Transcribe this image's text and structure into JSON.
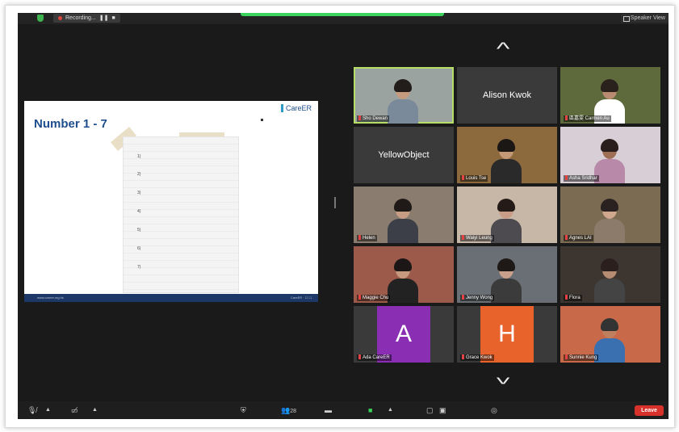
{
  "topbar": {
    "recording_label": "Recording...",
    "view_label": "Speaker View"
  },
  "slide": {
    "title": "Number 1 - 7",
    "logo": "CareER",
    "numbers": [
      "1)",
      "2)",
      "3)",
      "4)",
      "5)",
      "6)",
      "7)"
    ],
    "footer_left": "www.career.org.hk",
    "footer_right": "CareER · ☐ ☐"
  },
  "tiles": [
    {
      "name": "Sho Dewan",
      "type": "video",
      "skin": "#c59b7f",
      "hair": "#221c1a",
      "shirt": "#7a8a9a",
      "bg": "#9aa3a0",
      "active": true
    },
    {
      "name": "Alison Kwok",
      "type": "name"
    },
    {
      "name": "區嘉雯 Carmen Au",
      "type": "video",
      "skin": "#b98c71",
      "hair": "#2b211c",
      "shirt": "#ffffff",
      "bg": "#5e6a3c"
    },
    {
      "name": "YellowObject",
      "type": "name"
    },
    {
      "name": "Louis Tse",
      "type": "video",
      "skin": "#c49a76",
      "hair": "#1b1715",
      "shirt": "#2a2a2a",
      "bg": "#8c6a3e"
    },
    {
      "name": "Asha Sridhar",
      "type": "video",
      "skin": "#9f6f55",
      "hair": "#2a1f1d",
      "shirt": "#b889a9",
      "bg": "#d7cfd5"
    },
    {
      "name": "Helen",
      "type": "video",
      "skin": "#c69d83",
      "hair": "#1f1a18",
      "shirt": "#3c3f47",
      "bg": "#8a7d6f"
    },
    {
      "name": "Waiyi Leung",
      "type": "video",
      "skin": "#c89c86",
      "hair": "#241b18",
      "shirt": "#4d4b4f",
      "bg": "#c7b7a6"
    },
    {
      "name": "Agnes LAI",
      "type": "video",
      "skin": "#d0a88d",
      "hair": "#2a2220",
      "shirt": "#8c7b6b",
      "bg": "#7a6b52"
    },
    {
      "name": "Maggie Chu",
      "type": "video",
      "skin": "#c59a7f",
      "hair": "#1c1716",
      "shirt": "#222222",
      "bg": "#9c5a4a"
    },
    {
      "name": "Jenny Wong",
      "type": "video",
      "skin": "#c9a18a",
      "hair": "#1e1816",
      "shirt": "#3b3b3b",
      "bg": "#6a6e75"
    },
    {
      "name": "Flora",
      "type": "video",
      "skin": "#b68c73",
      "hair": "#2a1f1d",
      "shirt": "#444444",
      "bg": "#3d3630"
    },
    {
      "name": "Ada CareER",
      "type": "avatar",
      "letter": "A",
      "color": "#8a2fb4"
    },
    {
      "name": "Grace Kwok",
      "type": "avatar",
      "letter": "H",
      "color": "#e8622c"
    },
    {
      "name": "Sunnie Kung",
      "type": "video",
      "skin": "#c08060",
      "hair": "#333333",
      "shirt": "#3a6fb0",
      "bg": "#c86a4a"
    }
  ],
  "toolbar": {
    "participants_count": "28",
    "leave_label": "Leave"
  },
  "colors": {
    "active_border": "#b6dd66",
    "leave": "#d6312b",
    "recording": "#3ad35b"
  }
}
